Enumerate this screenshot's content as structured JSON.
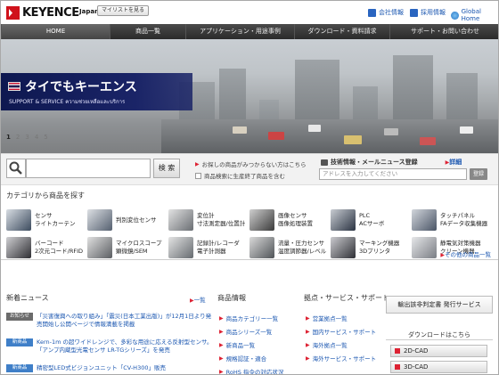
{
  "header": {
    "brand": "KEYENCE",
    "region": "Japan",
    "mylist_label": "マイリストを見る",
    "utility": [
      {
        "label": "会社情報",
        "icon": "building-icon",
        "color": "#1a56b0"
      },
      {
        "label": "採用情報",
        "icon": "person-icon",
        "color": "#1a56b0"
      },
      {
        "label": "Global Home",
        "icon": "globe-icon",
        "color": "#3a8ed8"
      }
    ]
  },
  "nav": {
    "items": [
      "HOME",
      "商品一覧",
      "アプリケーション・用途事例",
      "ダウンロード・資料請求",
      "サポート・お問い合わせ"
    ]
  },
  "hero": {
    "title": "タイでもキーエンス",
    "subtitle": "SUPPORT & SERVICE  ความช่วยเหลือและบริการ",
    "pages": [
      "1",
      "2",
      "3",
      "4",
      "5"
    ]
  },
  "search": {
    "placeholder": "",
    "button_label": "検 索",
    "options": [
      "お探しの商品がみつからない方はこちら",
      "商品検索に生産終了商品を含む"
    ]
  },
  "newsletter": {
    "label": "技術情報・メールニュース登録",
    "detail_link": "詳細",
    "placeholder": "アドレスを入力してください",
    "button_label": "登録"
  },
  "categories": {
    "title": "カテゴリから商品を探す",
    "items": [
      {
        "lines": [
          "センサ",
          "ライトカーテン"
        ],
        "color": "#3c4b5e"
      },
      {
        "lines": [
          "判別変位センサ"
        ],
        "color": "#556070"
      },
      {
        "lines": [
          "変位計",
          "寸法測定器/位置計"
        ],
        "color": "#6a6e73"
      },
      {
        "lines": [
          "画像センサ",
          "画像処理装置"
        ],
        "color": "#3a3a3a"
      },
      {
        "lines": [
          "PLC",
          "ACサーボ"
        ],
        "color": "#2a3342"
      },
      {
        "lines": [
          "タッチパネル",
          "FAデータ収集機器"
        ],
        "color": "#4a5566"
      },
      {
        "lines": [
          "バーコード",
          "2次元コード/RFID"
        ],
        "color": "#2e2e33"
      },
      {
        "lines": [
          "マイクロスコープ",
          "顕微鏡/SEM"
        ],
        "color": "#5b5e62"
      },
      {
        "lines": [
          "記録計/レコーダ",
          "電子計測器"
        ],
        "color": "#666b70"
      },
      {
        "lines": [
          "流量・圧力センサ",
          "温度調節器/レベル"
        ],
        "color": "#505458"
      },
      {
        "lines": [
          "マーキング機器",
          "3Dプリンタ"
        ],
        "color": "#2f3036"
      },
      {
        "lines": [
          "静電気対策機器",
          "クリーン機器"
        ],
        "color": "#7a7e84"
      }
    ],
    "more_link": "その他の商品一覧"
  },
  "news": {
    "title": "新着ニュース",
    "list_link": "一覧",
    "items": [
      {
        "tag": "お知らせ",
        "tag_color": "#6b6b6b",
        "text": "「災害復興への取り組み」「震災(日本工業出版)」が12月1日より発売開始し公開ページで情報満載を掲載"
      },
      {
        "tag": "新商品",
        "tag_color": "#3f7fc8",
        "text": "Kern-1m の超ワイドレンジで、多彩な用途に応える反射型センサ。「アンプ内蔵型光電センサ LR-TGシリーズ」を発売"
      },
      {
        "tag": "新商品",
        "tag_color": "#3f7fc8",
        "text": "精密型LED式ビジョンユニット「CV-H300」販売"
      }
    ]
  },
  "products": {
    "title": "商品情報",
    "items": [
      "商品カテゴリー一覧",
      "商品シリーズ一覧",
      "新商品一覧",
      "規格認証・適合",
      "RoHS 指令の対応状況"
    ]
  },
  "support": {
    "title": "拠点・サービス・サポート",
    "items": [
      "営業拠点一覧",
      "国内サービス・サポート",
      "海外拠点一覧",
      "海外サービス・サポート"
    ]
  },
  "right": {
    "transfer_label": "輸出該非判定書 発行サービス",
    "download_title": "ダウンロードはこちら",
    "cad": [
      "2D-CAD",
      "3D-CAD"
    ]
  }
}
